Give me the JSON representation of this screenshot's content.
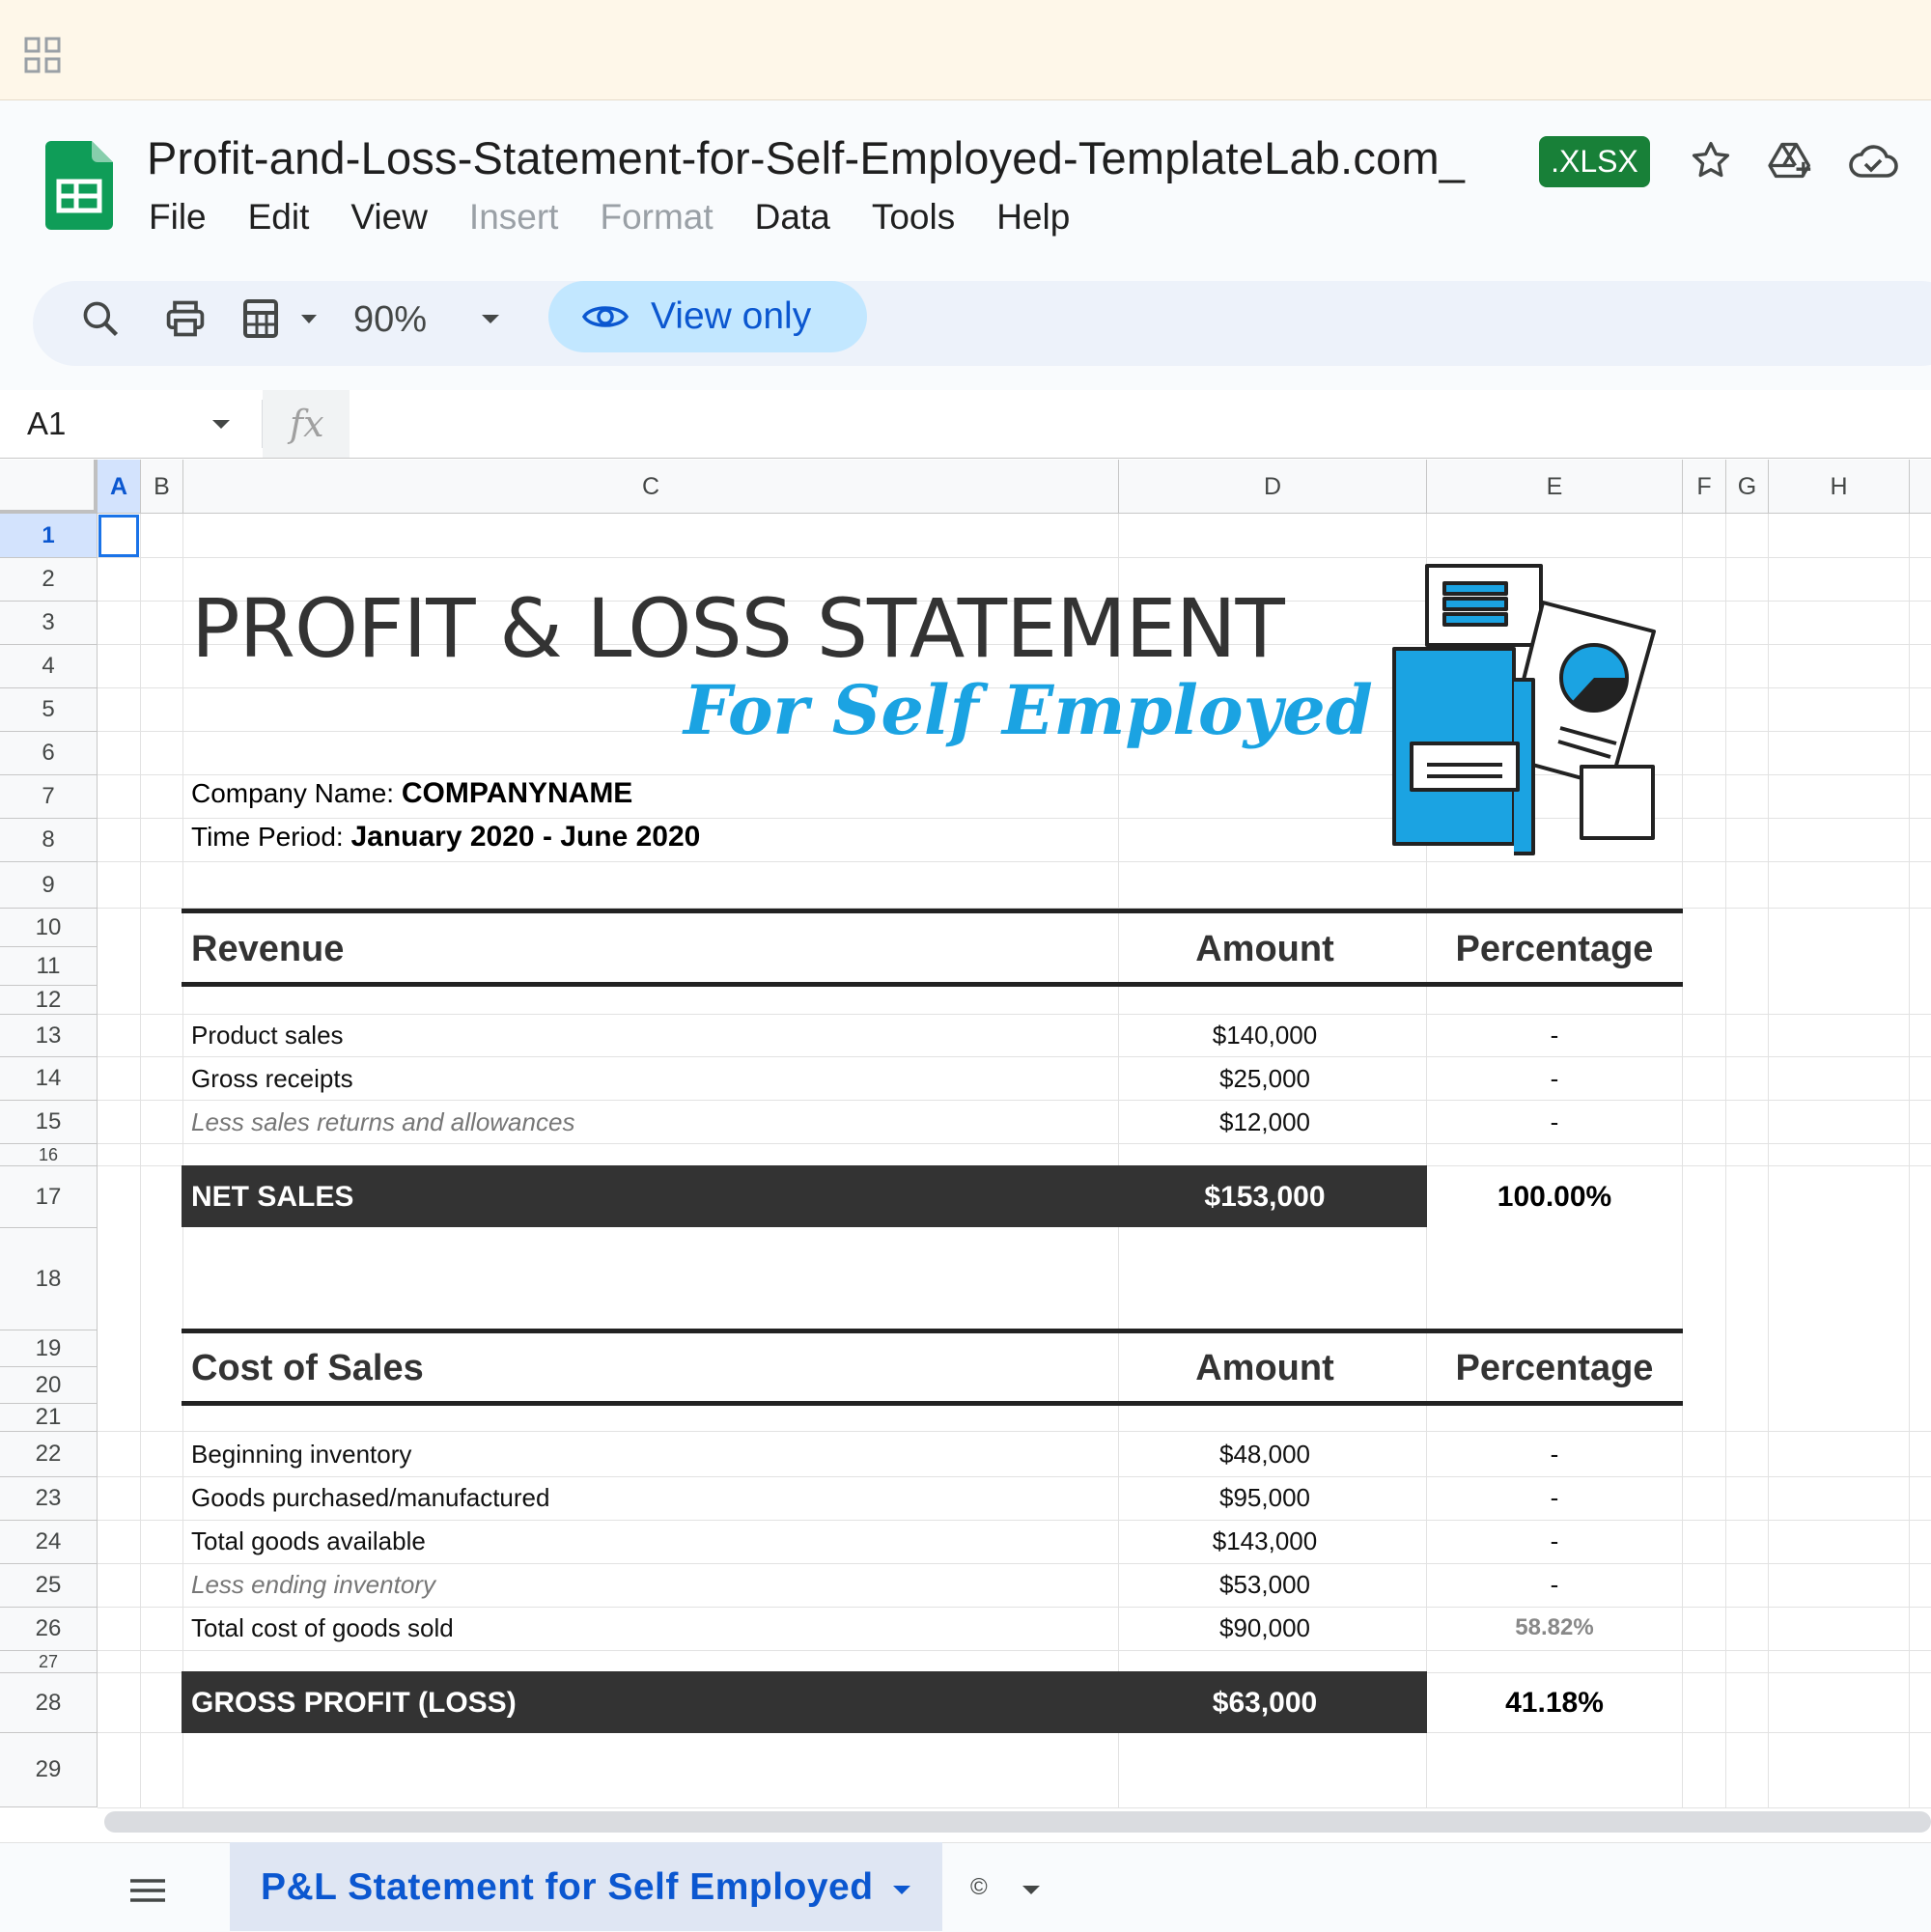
{
  "document": {
    "title": "Profit-and-Loss-Statement-for-Self-Employed-TemplateLab.com_",
    "badge": ".XLSX"
  },
  "menu": [
    "File",
    "Edit",
    "View",
    "Insert",
    "Format",
    "Data",
    "Tools",
    "Help"
  ],
  "menu_disabled": [
    "Insert",
    "Format"
  ],
  "toolbar": {
    "zoom": "90%",
    "view_only_label": "View only"
  },
  "formula_bar": {
    "cell_ref": "A1",
    "fx_label": "fx"
  },
  "columns": [
    "A",
    "B",
    "C",
    "D",
    "E",
    "F",
    "G",
    "H"
  ],
  "selected_cell": "A1",
  "rows": [
    "1",
    "2",
    "3",
    "4",
    "5",
    "6",
    "7",
    "8",
    "9",
    "10",
    "11",
    "12",
    "13",
    "14",
    "15",
    "16",
    "17",
    "18",
    "19",
    "20",
    "21",
    "22",
    "23",
    "24",
    "25",
    "26",
    "27",
    "28",
    "29"
  ],
  "sheet": {
    "title": "PROFIT & LOSS STATEMENT",
    "subtitle": "For Self Employed",
    "company_label": "Company Name:",
    "company_value": "COMPANYNAME",
    "period_label": "Time Period:",
    "period_value": "January 2020 - June 2020",
    "revenue": {
      "heading": "Revenue",
      "amount_heading": "Amount",
      "pct_heading": "Percentage",
      "items": [
        {
          "label": "Product sales",
          "amount": "$140,000",
          "pct": "-",
          "italic": false
        },
        {
          "label": "Gross receipts",
          "amount": "$25,000",
          "pct": "-",
          "italic": false
        },
        {
          "label": "Less sales returns and allowances",
          "amount": "$12,000",
          "pct": "-",
          "italic": true
        }
      ],
      "total_label": "NET SALES",
      "total_amount": "$153,000",
      "total_pct": "100.00%"
    },
    "cost_of_sales": {
      "heading": "Cost of Sales",
      "amount_heading": "Amount",
      "pct_heading": "Percentage",
      "items": [
        {
          "label": "Beginning inventory",
          "amount": "$48,000",
          "pct": "-",
          "italic": false
        },
        {
          "label": "Goods purchased/manufactured",
          "amount": "$95,000",
          "pct": "-",
          "italic": false
        },
        {
          "label": "Total goods available",
          "amount": "$143,000",
          "pct": "-",
          "italic": false
        },
        {
          "label": "Less ending inventory",
          "amount": "$53,000",
          "pct": "-",
          "italic": true
        },
        {
          "label": "Total cost of goods sold",
          "amount": "$90,000",
          "pct": "58.82%",
          "italic": false
        }
      ],
      "total_label": "GROSS PROFIT (LOSS)",
      "total_amount": "$63,000",
      "total_pct": "41.18%"
    }
  },
  "tabs": {
    "active": "P&L Statement for Self Employed",
    "other": "©"
  },
  "colors": {
    "brand_green": "#188038",
    "accent_blue": "#0b57d0",
    "subtitle_blue": "#1ba3e2",
    "total_bar": "#333333"
  }
}
